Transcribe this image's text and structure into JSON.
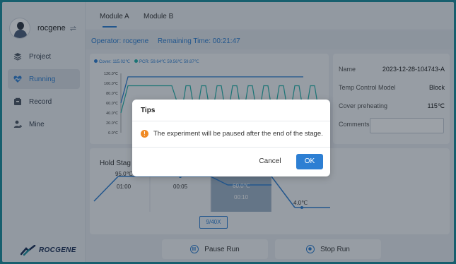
{
  "user": {
    "name": "rocgene",
    "swap_icon": "swap-icon"
  },
  "nav": [
    {
      "label": "Project",
      "icon": "layers-icon",
      "active": false
    },
    {
      "label": "Running",
      "icon": "heart-pulse-icon",
      "active": true
    },
    {
      "label": "Record",
      "icon": "record-icon",
      "active": false
    },
    {
      "label": "Mine",
      "icon": "user-plus-icon",
      "active": false
    }
  ],
  "logo": {
    "text": "ROCGENE"
  },
  "tabs": {
    "module_a": "Module A",
    "module_b": "Module B"
  },
  "status": {
    "operator": "Operator:  rocgene",
    "remaining": "Remaining Time: 00:21:47"
  },
  "chart_data": {
    "type": "line",
    "legend": [
      {
        "label": "Cover: 115.02℃",
        "color": "#2d7fd3"
      },
      {
        "label": "PCR: 59.64℃  59.56℃  59.87℃",
        "color": "#20b2aa"
      }
    ],
    "yticks": [
      "120.0℃",
      "100.0℃",
      "80.0℃",
      "60.0℃",
      "40.0℃",
      "20.0℃",
      "0.0℃"
    ],
    "ylim": [
      0,
      120
    ]
  },
  "info": {
    "name_label": "Name",
    "name_value": "2023-12-28-104743-A",
    "temp_model_label": "Temp Control Model",
    "temp_model_value": "Block",
    "cover_label": "Cover preheating",
    "cover_value": "115℃",
    "comments_label": "Comments"
  },
  "stages": {
    "hold_label": "Hold Stag",
    "step1_temp": "95.0℃",
    "step1_time": "01:00",
    "step2_time": "00:05",
    "step3_temp": "60.0℃",
    "step3_time": "00:10",
    "step4_temp": "4.0℃",
    "cycles": "9/40X"
  },
  "buttons": {
    "pause": "Pause Run",
    "stop": "Stop Run"
  },
  "dialog": {
    "title": "Tips",
    "message": "The experiment will be paused after the end of the stage.",
    "cancel": "Cancel",
    "ok": "OK"
  },
  "colors": {
    "accent": "#2d7fd3",
    "teal": "#1b8e9e",
    "warning": "#f08a24"
  }
}
